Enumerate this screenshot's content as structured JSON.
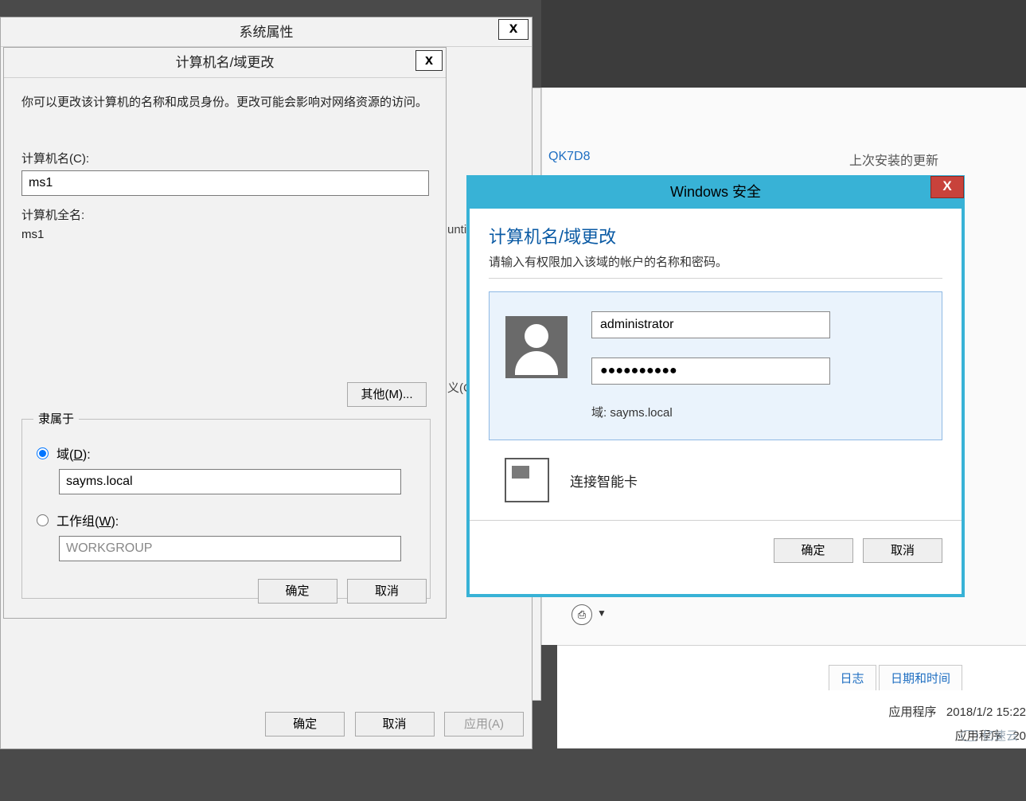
{
  "system_properties": {
    "title": "系统属性",
    "close": "x",
    "partial_tab": "                                                                                                                                                                                                                                                                                                                                                                                                                                                                                                                                                                                                                                                                                                                                                                                                                                                                                                                                                                                         (C",
    "buttons": {
      "ok": "确定",
      "cancel": "取消",
      "apply": "应用(A)"
    }
  },
  "name_change": {
    "title": "计算机名/域更改",
    "close": "x",
    "description": "你可以更改该计算机的名称和成员身份。更改可能会影响对网络资源的访问。",
    "computer_name_label": "计算机名(C):",
    "computer_name_value": "ms1",
    "full_name_label": "计算机全名:",
    "full_name_value": "ms1",
    "other_button": "其他(M)...",
    "member_of": "隶属于",
    "domain_label": "域(D):",
    "domain_value": "sayms.local",
    "workgroup_label": "工作组(W):",
    "workgroup_value": "WORKGROUP",
    "buttons": {
      "ok": "确定",
      "cancel": "取消"
    }
  },
  "right_panel": {
    "link": "QK7D8",
    "last_update": "上次安装的更新",
    "partial_prefix": "unti"
  },
  "security": {
    "title": "Windows 安全",
    "close": "X",
    "heading": "计算机名/域更改",
    "prompt": "请输入有权限加入该域的帐户的名称和密码。",
    "username": "administrator",
    "password": "●●●●●●●●●●",
    "domain_label": "域: sayms.local",
    "smartcard": "连接智能卡",
    "buttons": {
      "ok": "确定",
      "cancel": "取消"
    }
  },
  "bottom": {
    "save_icon": "⎙",
    "dropdown": "▼",
    "col_log": "日志",
    "col_date": "日期和时间",
    "row1_source": "应用程序",
    "row1_date": "2018/1/2 15:22",
    "row2_source": "应用程序",
    "row2_date": "20",
    "watermark": "亿速云"
  }
}
